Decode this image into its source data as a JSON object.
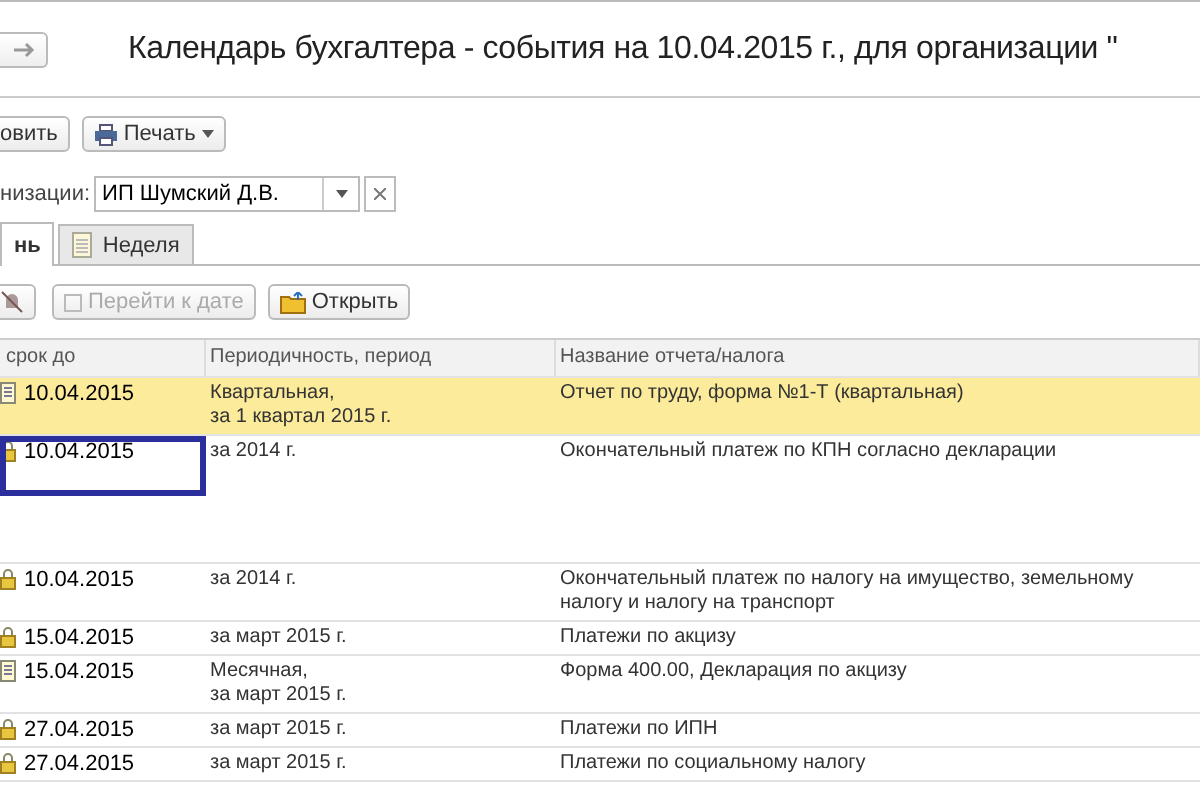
{
  "window": {
    "title": "Календарь бухгалтера - события на 10.04.2015 г., для организации \""
  },
  "toolbar": {
    "buttons": [
      {
        "label": "овить",
        "kind": "plain"
      },
      {
        "label": "Печать",
        "kind": "print"
      }
    ]
  },
  "organization": {
    "label": "низации:",
    "value": "ИП Шумский Д.В."
  },
  "tabs": [
    {
      "label": "нь",
      "selected": true
    },
    {
      "label": "Неделя",
      "selected": false
    }
  ],
  "actions": [
    {
      "kind": "icon",
      "disabled": false
    },
    {
      "kind": "goto",
      "label": "Перейти к дате",
      "disabled": true
    },
    {
      "kind": "open",
      "label": "Открыть",
      "disabled": false
    }
  ],
  "table": {
    "columns": [
      "срок до",
      "Периодичность, период",
      "Название отчета/налога"
    ],
    "rows": [
      {
        "kind": "report",
        "date": "10.04.2015",
        "period": [
          "Квартальная,",
          "за 1 квартал 2015 г."
        ],
        "name": "Отчет по труду, форма №1-Т (квартальная)",
        "selected": true,
        "focused": false,
        "tall": false
      },
      {
        "kind": "payment",
        "date": "10.04.2015",
        "period": [
          "за 2014 г."
        ],
        "name": "Окончательный платеж по КПН согласно декларации",
        "selected": false,
        "focused": true,
        "tall": true
      },
      {
        "kind": "payment",
        "date": "10.04.2015",
        "period": [
          "за 2014 г."
        ],
        "name": "Окончательный платеж по налогу на имущество, земельному налогу и налогу на транспорт",
        "selected": false,
        "focused": false,
        "tall": false
      },
      {
        "kind": "payment",
        "date": "15.04.2015",
        "period": [
          "за март 2015 г."
        ],
        "name": "Платежи по акцизу",
        "selected": false,
        "focused": false,
        "tall": false
      },
      {
        "kind": "report",
        "date": "15.04.2015",
        "period": [
          "Месячная,",
          "за март 2015 г."
        ],
        "name": "Форма 400.00, Декларация по акцизу",
        "selected": false,
        "focused": false,
        "tall": false
      },
      {
        "kind": "payment",
        "date": "27.04.2015",
        "period": [
          "за март 2015 г."
        ],
        "name": "Платежи по ИПН",
        "selected": false,
        "focused": false,
        "tall": false
      },
      {
        "kind": "payment",
        "date": "27.04.2015",
        "period": [
          "за март 2015 г."
        ],
        "name": "Платежи по социальному налогу",
        "selected": false,
        "focused": false,
        "tall": false
      }
    ]
  }
}
